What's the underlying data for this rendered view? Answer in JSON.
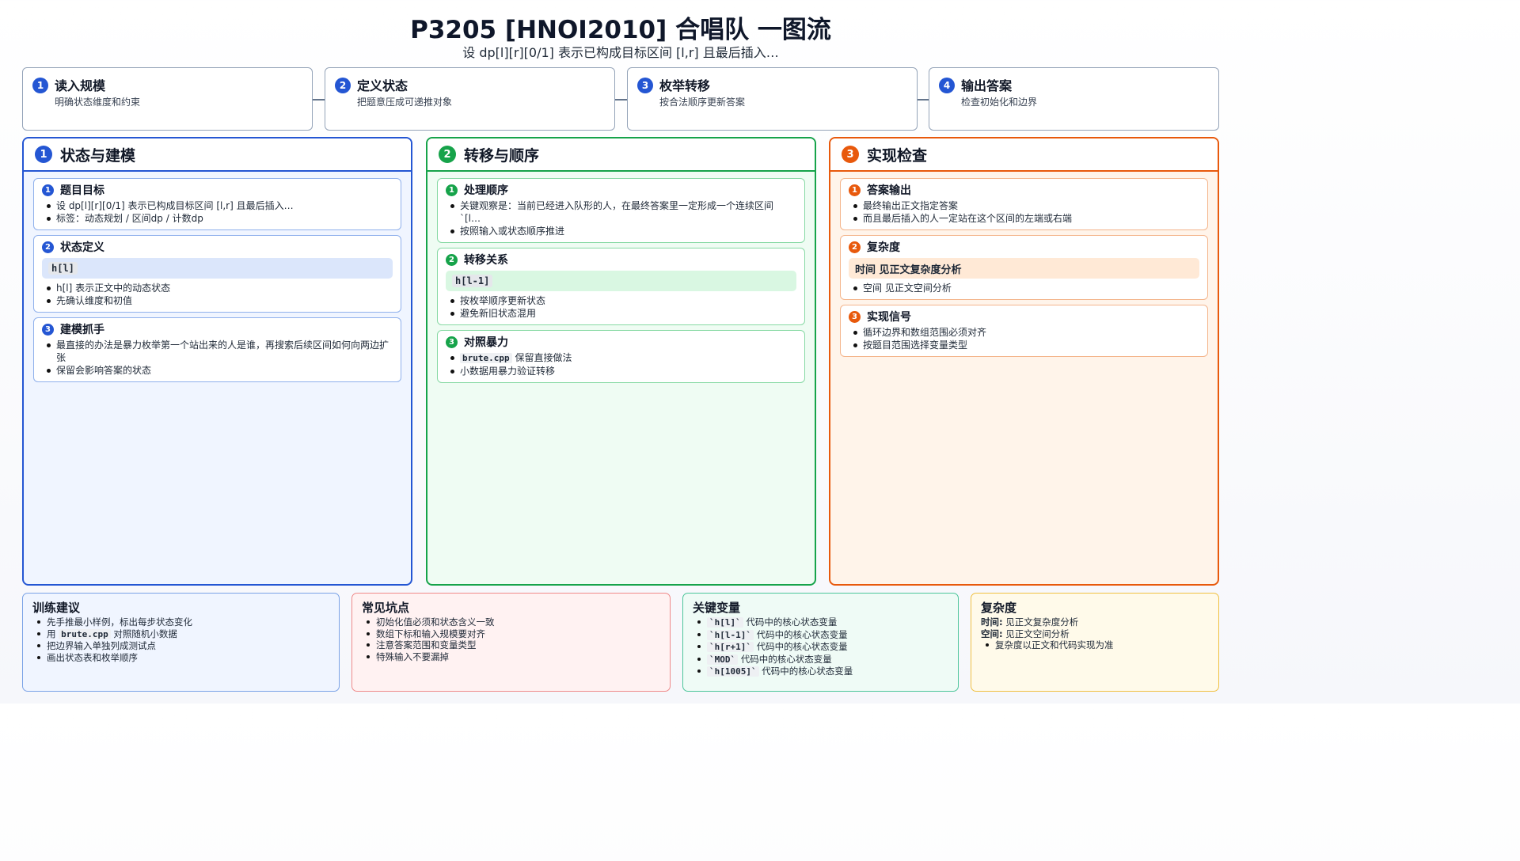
{
  "header": {
    "title": "P3205 [HNOI2010] 合唱队 一图流",
    "subtitle": "设 dp[l][r][0/1] 表示已构成目标区间 [l,r] 且最后插入…"
  },
  "steps": [
    {
      "num": "1",
      "title": "读入规模",
      "desc": "明确状态维度和约束"
    },
    {
      "num": "2",
      "title": "定义状态",
      "desc": "把题意压成可递推对象"
    },
    {
      "num": "3",
      "title": "枚举转移",
      "desc": "按合法顺序更新答案"
    },
    {
      "num": "4",
      "title": "输出答案",
      "desc": "检查初始化和边界"
    }
  ],
  "columns": [
    {
      "num": "1",
      "title": "状态与建模",
      "color": "#2456d3",
      "cards": [
        {
          "num": "1",
          "title": "题目目标",
          "items": [
            "设 dp[l][r][0/1] 表示已构成目标区间 [l,r] 且最后插入…",
            "标签：动态规划 / 区间dp / 计数dp"
          ]
        },
        {
          "num": "2",
          "title": "状态定义",
          "code": "h[l]",
          "items": [
            "h[l] 表示正文中的动态状态",
            "先确认维度和初值"
          ]
        },
        {
          "num": "3",
          "title": "建模抓手",
          "items": [
            "最直接的办法是暴力枚举第一个站出来的人是谁，再搜索后续区间如何向两边扩张",
            "保留会影响答案的状态"
          ]
        }
      ]
    },
    {
      "num": "2",
      "title": "转移与顺序",
      "color": "#16a34a",
      "cards": [
        {
          "num": "1",
          "title": "处理顺序",
          "items": [
            "关键观察是：当前已经进入队形的人，在最终答案里一定形成一个连续区间 `[l…",
            "按照输入或状态顺序推进"
          ]
        },
        {
          "num": "2",
          "title": "转移关系",
          "code": "h[l-1]",
          "items": [
            "按枚举顺序更新状态",
            "避免新旧状态混用"
          ]
        },
        {
          "num": "3",
          "title": "对照暴力",
          "items": [
            "brute.cpp",
            "保留直接做法",
            "小数据用暴力验证转移"
          ]
        }
      ]
    },
    {
      "num": "3",
      "title": "实现检查",
      "color": "#e8590c",
      "cards": [
        {
          "num": "1",
          "title": "答案输出",
          "items": [
            "最终输出正文指定答案",
            "而且最后插入的人一定站在这个区间的左端或右端"
          ]
        },
        {
          "num": "2",
          "title": "复杂度",
          "highlight": "时间 见正文复杂度分析",
          "items": [
            "空间 见正文空间分析"
          ]
        },
        {
          "num": "3",
          "title": "实现信号",
          "items": [
            "循环边界和数组范围必须对齐",
            "按题目范围选择变量类型"
          ]
        }
      ]
    }
  ],
  "bottom": {
    "training": {
      "title": "训练建议",
      "items": [
        "先手推最小样例，标出每步状态变化",
        "用",
        "brute.cpp",
        "对照随机小数据",
        "把边界输入单独列成测试点",
        "画出状态表和枚举顺序"
      ]
    },
    "pitfalls": {
      "title": "常见坑点",
      "items": [
        "初始化值必须和状态含义一致",
        "数组下标和输入规模要对齐",
        "注意答案范围和变量类型",
        "特殊输入不要漏掉"
      ]
    },
    "vars": {
      "title": "关键变量",
      "code": [
        "`h[l]`",
        "`h[l-1]`",
        "`h[r+1]`",
        "`MOD`",
        "`h[1005]`"
      ],
      "suffix": "代码中的核心状态变量"
    },
    "complexity": {
      "title": "复杂度",
      "time_label": "时间:",
      "time": "见正文复杂度分析",
      "space_label": "空间:",
      "space": "见正文空间分析",
      "note": "复杂度以正文和代码实现为准"
    }
  }
}
